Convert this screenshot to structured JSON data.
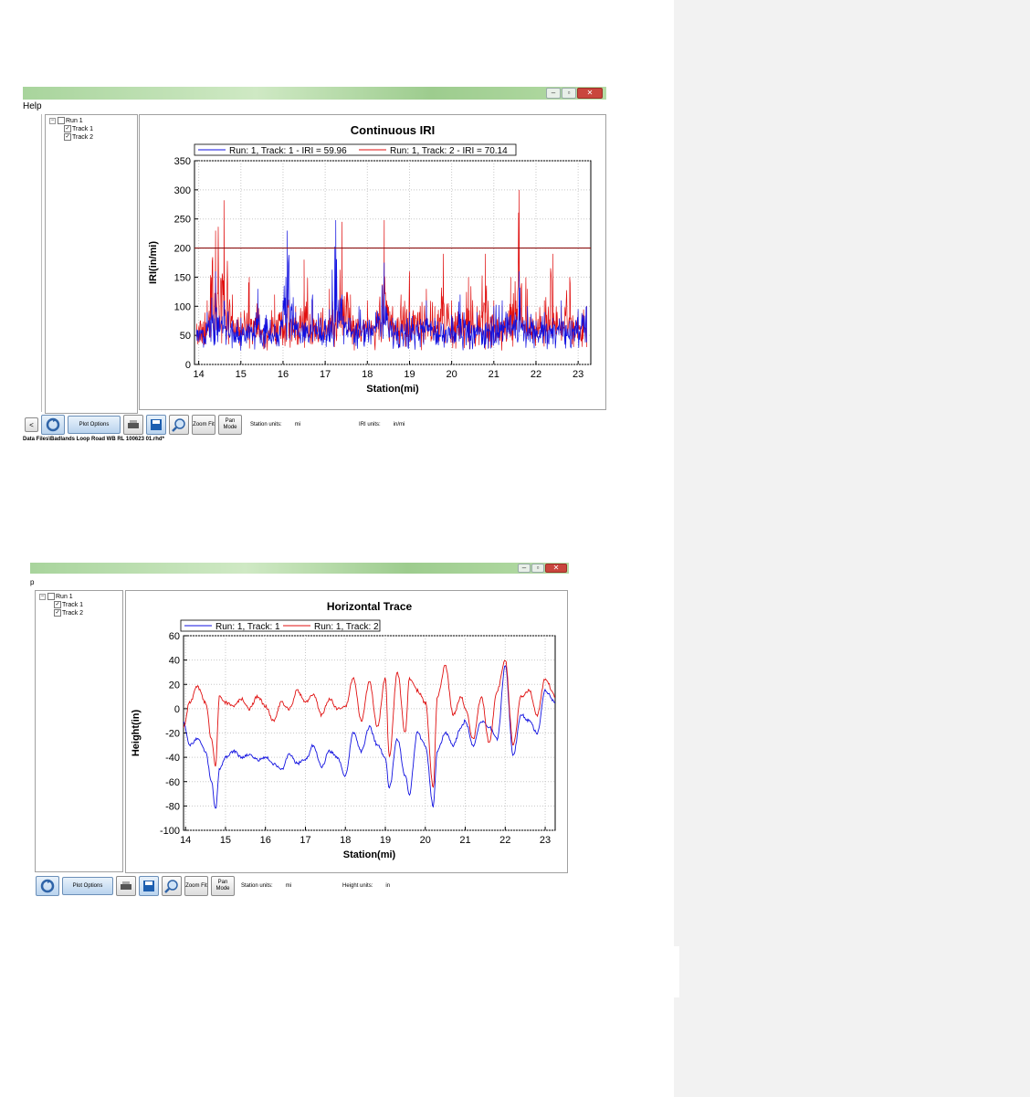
{
  "window1": {
    "menu": {
      "help": "Help"
    },
    "tree": {
      "root": "Run 1",
      "items": [
        "Track 1",
        "Track 2"
      ]
    },
    "toolbar": {
      "back": "<",
      "plot_options": "Plot Options",
      "zoom_fit": "Zoom Fit",
      "pan_mode": "Pan Mode",
      "station_units_label": "Station units:",
      "station_units_value": "mi",
      "y_units_label": "IRI units:",
      "y_units_value": "in/mi"
    },
    "status_path": "Data Files\\Badlands Loop Road  WB  RL  100623  01.rhd*"
  },
  "window2": {
    "menu": {
      "help": "p"
    },
    "tree": {
      "root": "Run 1",
      "items": [
        "Track 1",
        "Track 2"
      ]
    },
    "toolbar": {
      "plot_options": "Plot Options",
      "zoom_fit": "Zoom Fit",
      "pan_mode": "Pan Mode",
      "station_units_label": "Station units:",
      "station_units_value": "mi",
      "y_units_label": "Height units:",
      "y_units_value": "in"
    }
  },
  "chart_data": [
    {
      "type": "line",
      "title": "Continuous IRI",
      "xlabel": "Station(mi)",
      "ylabel": "IRI(in/mi)",
      "xlim": [
        13.9,
        23.3
      ],
      "ylim": [
        0,
        350
      ],
      "xticks": [
        14,
        15,
        16,
        17,
        18,
        19,
        20,
        21,
        22,
        23
      ],
      "yticks": [
        0,
        50,
        100,
        150,
        200,
        250,
        300,
        350
      ],
      "grid": true,
      "legend": "top",
      "threshold": 200,
      "series": [
        {
          "name": "Run: 1, Track: 1 - IRI = 59.96",
          "color": "#1010e0",
          "x": [
            13.95,
            14.2,
            14.4,
            14.6,
            14.8,
            15.0,
            15.2,
            15.4,
            15.6,
            15.8,
            16.0,
            16.1,
            16.3,
            16.5,
            16.7,
            16.9,
            17.1,
            17.25,
            17.4,
            17.6,
            17.8,
            18.0,
            18.2,
            18.4,
            18.6,
            18.8,
            19.0,
            19.2,
            19.4,
            19.6,
            19.8,
            20.0,
            20.2,
            20.4,
            20.6,
            20.8,
            21.0,
            21.2,
            21.4,
            21.6,
            21.8,
            22.0,
            22.2,
            22.4,
            22.6,
            22.8,
            23.0,
            23.2
          ],
          "y": [
            60,
            90,
            160,
            110,
            75,
            80,
            70,
            130,
            85,
            70,
            110,
            230,
            90,
            70,
            120,
            80,
            95,
            248,
            120,
            80,
            100,
            75,
            90,
            175,
            80,
            70,
            90,
            75,
            110,
            80,
            70,
            85,
            120,
            75,
            90,
            70,
            100,
            110,
            85,
            160,
            100,
            75,
            90,
            80,
            110,
            75,
            95,
            100
          ]
        },
        {
          "name": "Run: 1, Track: 2 - IRI = 70.14",
          "color": "#e01010",
          "x": [
            13.95,
            14.2,
            14.4,
            14.6,
            14.8,
            15.0,
            15.2,
            15.4,
            15.6,
            15.8,
            16.0,
            16.1,
            16.3,
            16.5,
            16.7,
            16.9,
            17.1,
            17.25,
            17.4,
            17.6,
            17.8,
            18.0,
            18.2,
            18.4,
            18.6,
            18.8,
            19.0,
            19.2,
            19.4,
            19.6,
            19.8,
            20.0,
            20.2,
            20.4,
            20.6,
            20.8,
            21.0,
            21.2,
            21.4,
            21.6,
            21.8,
            22.0,
            22.2,
            22.4,
            22.6,
            22.8,
            23.0,
            23.2
          ],
          "y": [
            70,
            110,
            230,
            282,
            120,
            90,
            150,
            100,
            80,
            120,
            95,
            130,
            100,
            180,
            110,
            90,
            130,
            110,
            245,
            120,
            90,
            110,
            80,
            248,
            100,
            120,
            160,
            90,
            130,
            100,
            190,
            110,
            90,
            150,
            100,
            190,
            110,
            100,
            150,
            300,
            130,
            90,
            110,
            190,
            100,
            150,
            90,
            100
          ]
        }
      ]
    },
    {
      "type": "line",
      "title": "Horizontal Trace",
      "xlabel": "Station(mi)",
      "ylabel": "Height(in)",
      "xlim": [
        13.95,
        23.25
      ],
      "ylim": [
        -100,
        60
      ],
      "xticks": [
        14,
        15,
        16,
        17,
        18,
        19,
        20,
        21,
        22,
        23
      ],
      "yticks": [
        -100,
        -80,
        -60,
        -40,
        -20,
        0,
        20,
        40,
        60
      ],
      "grid": true,
      "legend": "top",
      "series": [
        {
          "name": "Run: 1, Track: 1",
          "color": "#1010e0",
          "x": [
            13.95,
            14.1,
            14.3,
            14.5,
            14.65,
            14.75,
            14.85,
            15.0,
            15.2,
            15.4,
            15.6,
            15.8,
            16.0,
            16.2,
            16.4,
            16.6,
            16.8,
            17.0,
            17.2,
            17.4,
            17.6,
            17.8,
            18.0,
            18.2,
            18.4,
            18.6,
            18.8,
            19.0,
            19.1,
            19.3,
            19.5,
            19.6,
            19.8,
            20.0,
            20.2,
            20.3,
            20.5,
            20.7,
            20.9,
            21.0,
            21.2,
            21.4,
            21.6,
            21.8,
            22.0,
            22.2,
            22.4,
            22.6,
            22.8,
            23.0,
            23.25
          ],
          "y": [
            -10,
            -30,
            -25,
            -35,
            -60,
            -83,
            -50,
            -40,
            -35,
            -40,
            -38,
            -42,
            -40,
            -45,
            -50,
            -38,
            -45,
            -42,
            -30,
            -48,
            -35,
            -40,
            -55,
            -20,
            -35,
            -15,
            -30,
            -40,
            -65,
            -25,
            -55,
            -70,
            -20,
            -30,
            -80,
            -35,
            -20,
            -30,
            -15,
            -10,
            -30,
            -10,
            -15,
            -25,
            35,
            -38,
            -5,
            -10,
            -20,
            15,
            5
          ]
        },
        {
          "name": "Run: 1, Track: 2",
          "color": "#e01010",
          "x": [
            13.95,
            14.1,
            14.3,
            14.5,
            14.65,
            14.75,
            14.85,
            15.0,
            15.2,
            15.4,
            15.6,
            15.8,
            16.0,
            16.2,
            16.4,
            16.6,
            16.8,
            17.0,
            17.2,
            17.4,
            17.6,
            17.8,
            18.0,
            18.2,
            18.4,
            18.6,
            18.8,
            19.0,
            19.1,
            19.3,
            19.5,
            19.6,
            19.8,
            20.0,
            20.2,
            20.3,
            20.5,
            20.7,
            20.9,
            21.0,
            21.2,
            21.4,
            21.6,
            21.8,
            22.0,
            22.2,
            22.4,
            22.6,
            22.8,
            23.0,
            23.25
          ],
          "y": [
            -15,
            5,
            18,
            5,
            -25,
            -48,
            10,
            5,
            2,
            8,
            0,
            10,
            2,
            -10,
            5,
            0,
            15,
            5,
            12,
            -5,
            8,
            0,
            2,
            25,
            -10,
            22,
            -15,
            25,
            -40,
            30,
            -20,
            25,
            15,
            5,
            -65,
            10,
            35,
            -5,
            10,
            0,
            -25,
            10,
            -28,
            15,
            40,
            -30,
            10,
            15,
            -5,
            25,
            10
          ]
        }
      ]
    }
  ]
}
